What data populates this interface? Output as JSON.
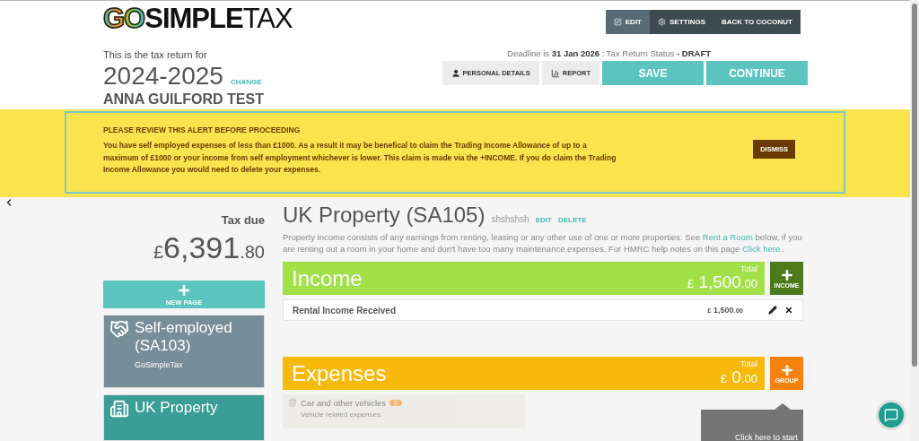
{
  "logo": {
    "part_1": "GO",
    "part_2": "SIMPLE",
    "part_3": "TAX"
  },
  "nav": [
    {
      "label": "EDIT",
      "selected": true
    },
    {
      "label": "SETTINGS",
      "selected": false
    },
    {
      "label": "BACK TO COCONUT",
      "selected": false
    }
  ],
  "return_intro": "This is the tax return for",
  "tax_year": "2024-2025",
  "change_link": "CHANGE",
  "taxpayer_name": "ANNA GUILFORD TEST",
  "deadline": {
    "prefix": "Deadline is",
    "date": "31 Jan 2026",
    "separator": ": Tax Return Status",
    "status": "- DRAFT"
  },
  "actions": [
    {
      "label": "PERSONAL DETAILS",
      "kind": "secondary"
    },
    {
      "label": "REPORT",
      "kind": "secondary"
    },
    {
      "label": "SAVE",
      "kind": "primary"
    },
    {
      "label": "CONTINUE",
      "kind": "primary"
    }
  ],
  "alert": {
    "title": "PLEASE REVIEW THIS ALERT BEFORE PROCEEDING",
    "message": "You have self employed expenses of less than £1000. As a result it may be benefical to claim the Trading Income Allowance of up to a maximum of £1000 or your income from self employment whichever is lower. This claim is made via the +INCOME. If you do claim the Trading Income Allowance you would need to delete your expenses.",
    "button": "DISMISS"
  },
  "tax_due": {
    "label": "Tax due",
    "currency": "£",
    "whole": "6,391",
    "decimals": ".80"
  },
  "new_page_button": "NEW PAGE",
  "sidebar_pages": [
    {
      "title": "Self-employed (SA103)",
      "subtitle": "GoSimpleTax",
      "selected": false
    },
    {
      "title": "UK Property",
      "selected": true
    }
  ],
  "page": {
    "title": "UK Property (SA105)",
    "nickname": "shshshsh",
    "edit_link": "EDIT",
    "delete_link": "DELETE",
    "description": [
      {
        "kind": "text",
        "text": "Property income consists of any earnings from renting, leasing or any other use of one or more properties. See "
      },
      {
        "kind": "link",
        "text": "Rent a Room"
      },
      {
        "kind": "text",
        "text": " below, if you are renting out a room in your home and don't have too many maintenance expenses. For HMRC help notes on this page "
      },
      {
        "kind": "link",
        "text": "Click here"
      },
      {
        "kind": "text",
        "text": " ."
      }
    ]
  },
  "sections": [
    {
      "kind": "income",
      "title": "Income",
      "total_label": "Total",
      "currency": "£",
      "whole": "1,500",
      "decimals": ".00",
      "add_button": "INCOME",
      "rows": [
        {
          "kind": "entry",
          "label": "Rental Income Received",
          "currency": "£",
          "whole": "1,500",
          "decimals": ".00"
        }
      ]
    },
    {
      "kind": "expenses",
      "title": "Expenses",
      "total_label": "Total",
      "currency": "£",
      "whole": "0",
      "decimals": ".00",
      "add_button": "GROUP",
      "rows": [
        {
          "kind": "group",
          "label": "Car and other vehicles",
          "count": "0",
          "subtitle": "Vehicle related expenses."
        }
      ]
    }
  ],
  "tooltip": "Click here to start"
}
